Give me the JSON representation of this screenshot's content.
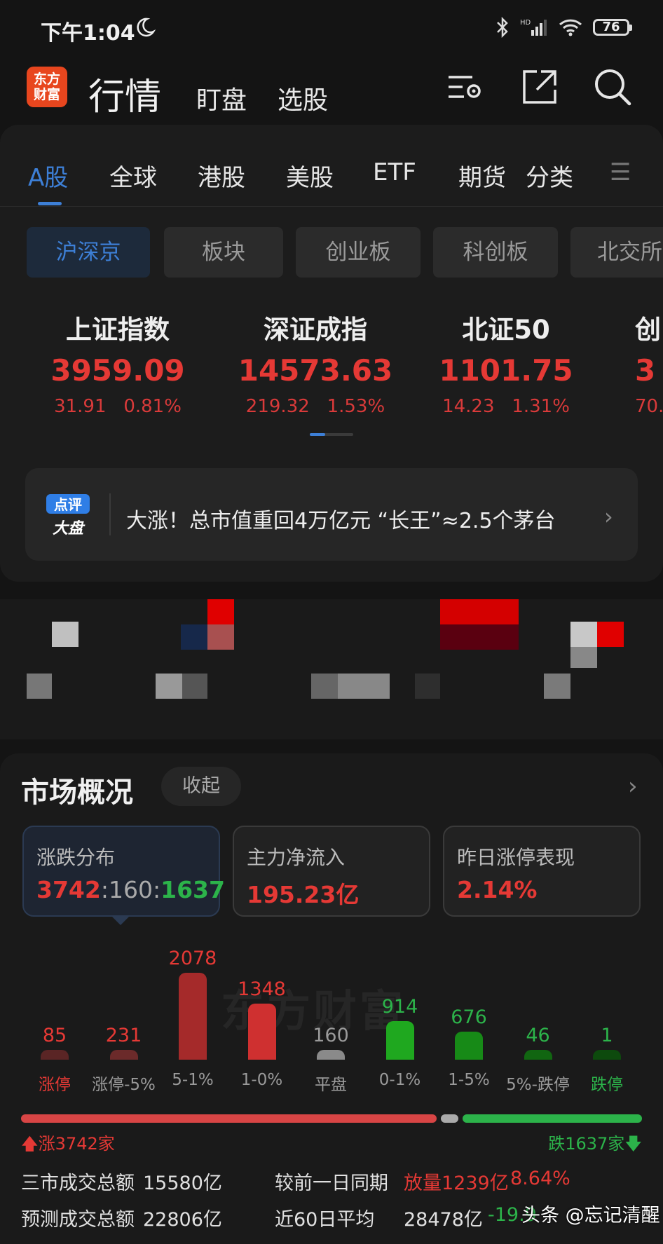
{
  "status_bar": {
    "time": "下午1:04",
    "battery": "76"
  },
  "header": {
    "logo_line1": "东方",
    "logo_line2": "财富",
    "title": "行情",
    "tabs": [
      "盯盘",
      "选股"
    ]
  },
  "market_tabs": [
    "A股",
    "全球",
    "港股",
    "美股",
    "ETF",
    "期货",
    "分类"
  ],
  "sub_tabs": [
    "沪深京",
    "板块",
    "创业板",
    "科创板",
    "北交所"
  ],
  "indices": [
    {
      "name": "上证指数",
      "value": "3959.09",
      "change": "31.91",
      "pct": "0.81%"
    },
    {
      "name": "深证成指",
      "value": "14573.63",
      "change": "219.32",
      "pct": "1.53%"
    },
    {
      "name": "北证50",
      "value": "1101.75",
      "change": "14.23",
      "pct": "1.31%"
    },
    {
      "name": "创",
      "value": "3",
      "change": "70.",
      "pct": ""
    }
  ],
  "news": {
    "badge_line1": "点评",
    "badge_line2": "大盘",
    "text": "大涨！总市值重回4万亿元 “长王”≈2.5个茅台"
  },
  "market_overview": {
    "title": "市场概况",
    "collapse_label": "收起",
    "cards": [
      {
        "label": "涨跌分布",
        "up": "3742",
        "flat": "160",
        "down": "1637",
        "sep": ":"
      },
      {
        "label": "主力净流入",
        "value": "195.23亿"
      },
      {
        "label": "昨日涨停表现",
        "value": "2.14%"
      }
    ],
    "watermark": "东方财富",
    "up_total": "涨3742家",
    "down_total": "跌1637家",
    "stats": {
      "turnover_label": "三市成交总额",
      "turnover_value": "15580亿",
      "compare_label": "较前一日同期",
      "compare_value": "放量1239亿",
      "compare_pct": "8.64%",
      "forecast_label": "预测成交总额",
      "forecast_value": "22806亿",
      "avg_label": "近60日平均",
      "avg_value": "28478亿",
      "avg_pct": "-19.9"
    }
  },
  "chart_data": {
    "type": "bar",
    "categories": [
      "涨停",
      "涨停-5%",
      "5-1%",
      "1-0%",
      "平盘",
      "0-1%",
      "1-5%",
      "5%-跌停",
      "跌停"
    ],
    "values": [
      85,
      231,
      2078,
      1348,
      160,
      914,
      676,
      46,
      1
    ],
    "colors": [
      "#5a2525",
      "#6b2a2a",
      "#a52a2a",
      "#cf3030",
      "#8a8a8a",
      "#1fa81f",
      "#178a17",
      "#116611",
      "#0d4a0d"
    ],
    "label_colors": [
      "#e53935",
      "#e53935",
      "#e53935",
      "#e53935",
      "#9a9a9a",
      "#2cb34a",
      "#2cb34a",
      "#2cb34a",
      "#2cb34a"
    ],
    "category_colors": [
      "#e53935",
      "#9a9a9a",
      "#9a9a9a",
      "#9a9a9a",
      "#9a9a9a",
      "#9a9a9a",
      "#9a9a9a",
      "#9a9a9a",
      "#2cb34a"
    ]
  },
  "ratio_bar": {
    "up": 3742,
    "flat": 160,
    "down": 1637
  },
  "footer_watermark": "头条 @忘记清醒"
}
